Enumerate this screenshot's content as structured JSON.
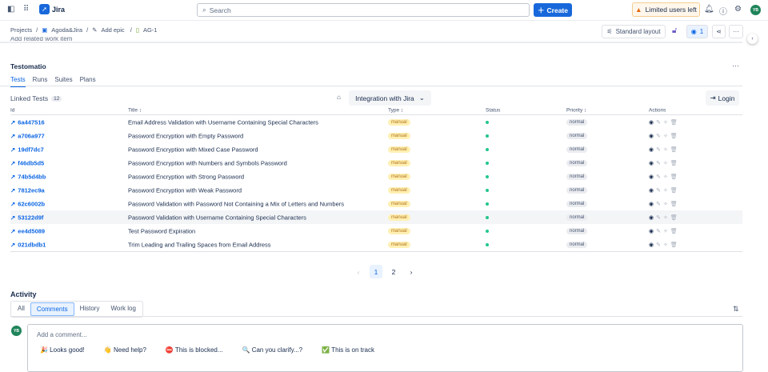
{
  "topbar": {
    "app_name": "Jira",
    "search_placeholder": "Search",
    "create_label": "Create",
    "limited_label": "Limited users left",
    "avatar_initials": "YB"
  },
  "breadcrumb": [
    "Projects",
    "Agoda&Jira",
    "Add epic",
    "AG-1"
  ],
  "toolbar": {
    "layout_label": "Standard layout",
    "watch_count": "1"
  },
  "cut_text": "Add related work item",
  "panel": {
    "title": "Testomatio",
    "tabs": [
      "Tests",
      "Runs",
      "Suites",
      "Plans"
    ],
    "linked_label": "Linked Tests",
    "linked_count": "12",
    "integration_label": "Integration with Jira",
    "login_label": "Login"
  },
  "table": {
    "headers": [
      "Id",
      "Title ↕",
      "Type ↕",
      "Status",
      "Priority ↕",
      "Actions"
    ],
    "rows": [
      {
        "id": "6a447516",
        "title": "Email Address Validation with Username Containing Special Characters",
        "type": "manual",
        "priority": "normal"
      },
      {
        "id": "a706a977",
        "title": "Password Encryption with Empty Password",
        "type": "manual",
        "priority": "normal"
      },
      {
        "id": "19df7dc7",
        "title": "Password Encryption with Mixed Case Password",
        "type": "manual",
        "priority": "normal"
      },
      {
        "id": "f46db5d5",
        "title": "Password Encryption with Numbers and Symbols Password",
        "type": "manual",
        "priority": "normal"
      },
      {
        "id": "74b5d4bb",
        "title": "Password Encryption with Strong Password",
        "type": "manual",
        "priority": "normal"
      },
      {
        "id": "7812ec9a",
        "title": "Password Encryption with Weak Password",
        "type": "manual",
        "priority": "normal"
      },
      {
        "id": "62c6002b",
        "title": "Password Validation with Password Not Containing a Mix of Letters and Numbers",
        "type": "manual",
        "priority": "normal"
      },
      {
        "id": "53122d9f",
        "title": "Password Validation with Username Containing Special Characters",
        "type": "manual",
        "priority": "normal"
      },
      {
        "id": "ee4d5089",
        "title": "Test Password Expiration",
        "type": "manual",
        "priority": "normal"
      },
      {
        "id": "021dbdb1",
        "title": "Trim Leading and Trailing Spaces from Email Address",
        "type": "manual",
        "priority": "normal"
      }
    ]
  },
  "pagination": {
    "pages": [
      "1",
      "2"
    ],
    "current": "1"
  },
  "activity": {
    "title": "Activity",
    "tabs": [
      "All",
      "Comments",
      "History",
      "Work log"
    ],
    "active_tab": "Comments",
    "comment_placeholder": "Add a comment...",
    "quick_replies": [
      "🎉 Looks good!",
      "👋 Need help?",
      "⛔ This is blocked...",
      "🔍 Can you clarify...?",
      "✅ This is on track"
    ]
  },
  "colors": {
    "accent": "#1868db",
    "link": "#0c66e4",
    "status_ok": "#22c58b"
  }
}
